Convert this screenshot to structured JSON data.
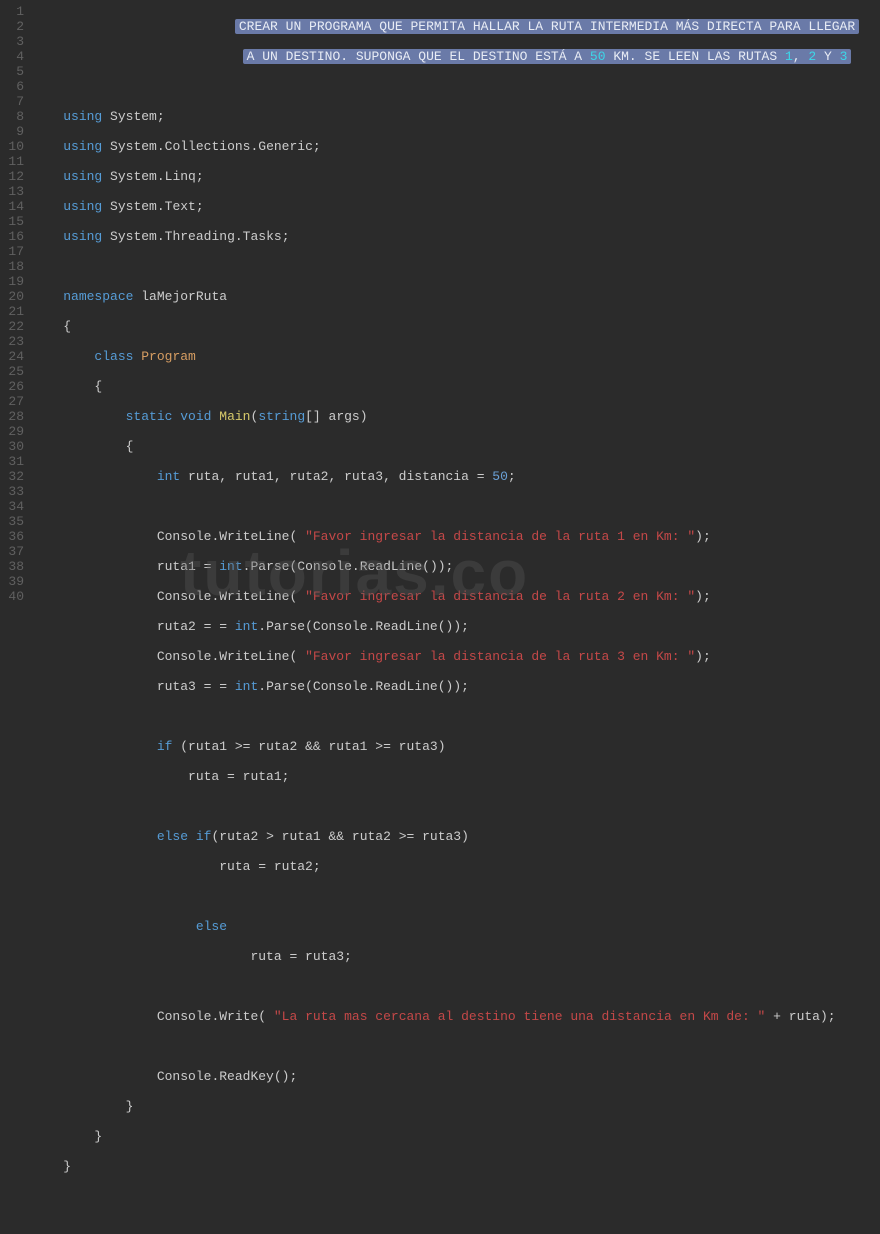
{
  "lineCount": 40,
  "watermark": "tutorias.co",
  "comment": {
    "line1_prefix": "                          ",
    "line1_text": "CREAR UN PROGRAMA QUE PERMITA HALLAR LA RUTA INTERMEDIA MÁS DIRECTA PARA LLEGAR",
    "line2_prefix": "                           ",
    "line2_text_a": "A UN DESTINO. SUPONGA QUE EL DESTINO ESTÁ A ",
    "line2_num": "50",
    "line2_text_b": " KM. SE LEEN LAS RUTAS ",
    "line2_r1": "1",
    "line2_comma1": ", ",
    "line2_r2": "2",
    "line2_y": " Y ",
    "line2_r3": "3"
  },
  "usings": {
    "u1": "System",
    "u2": "System.Collections.Generic",
    "u3": "System.Linq",
    "u4": "System.Text",
    "u5": "System.Threading.Tasks"
  },
  "ns": "laMejorRuta",
  "cls": "Program",
  "main": {
    "staticKw": "static",
    "voidKw": "void",
    "name": "Main",
    "argType": "string",
    "argName": "args"
  },
  "decl": {
    "type": "int",
    "vars": "ruta, ruta1, ruta2, ruta3, distancia = ",
    "val": "50"
  },
  "prompts": {
    "p1": "\"Favor ingresar la distancia de la ruta 1 en Km: \"",
    "p2": "\"Favor ingresar la distancia de la ruta 2 en Km: \"",
    "p3": "\"Favor ingresar la distancia de la ruta 3 en Km: \"",
    "out": "\"La ruta mas cercana al destino tiene una distancia en Km de: \""
  },
  "tokens": {
    "using": "using",
    "namespace": "namespace",
    "class": "class",
    "int": "int",
    "if": "if",
    "else": "else",
    "Console": "Console",
    "WriteLine": "WriteLine",
    "Write": "Write",
    "ReadLine": "ReadLine",
    "ReadKey": "ReadKey",
    "Parse": "Parse"
  },
  "logic": {
    "assign1": "ruta1 = ",
    "assign2": "ruta2 = = ",
    "assign3": "ruta3 = = ",
    "cond1": "(ruta1 >= ruta2 && ruta1 >= ruta3)",
    "body1": "ruta = ruta1;",
    "cond2": "(ruta2 > ruta1 && ruta2 >= ruta3)",
    "body2": "ruta = ruta2;",
    "body3": "ruta = ruta3;",
    "outSuffix": " + ruta);"
  }
}
